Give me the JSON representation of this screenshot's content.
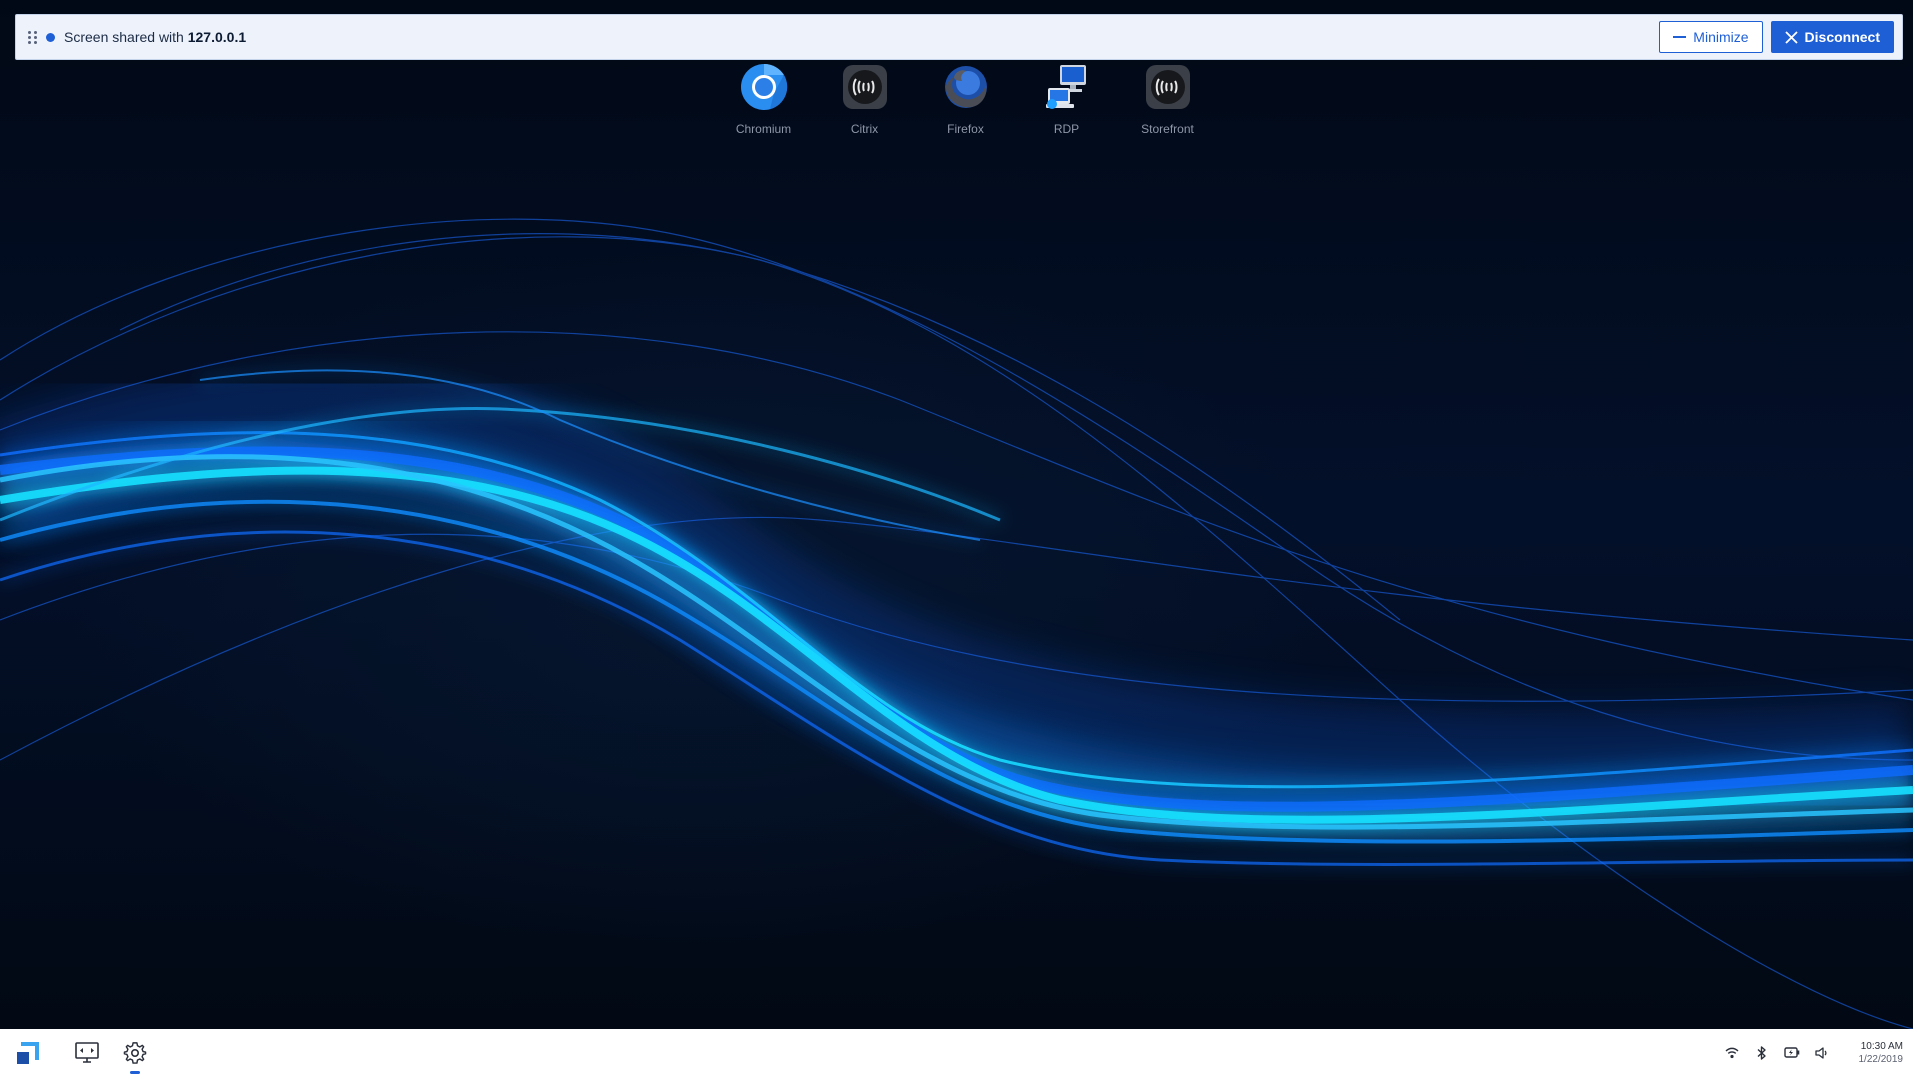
{
  "share_bar": {
    "text_prefix": "Screen shared with",
    "ip": "127.0.0.1",
    "minimize_label": "Minimize",
    "disconnect_label": "Disconnect"
  },
  "desktop_icons": [
    {
      "label": "Chromium",
      "icon": "chromium-icon"
    },
    {
      "label": "Citrix",
      "icon": "citrix-icon"
    },
    {
      "label": "Firefox",
      "icon": "firefox-icon"
    },
    {
      "label": "RDP",
      "icon": "rdp-icon"
    },
    {
      "label": "Storefront",
      "icon": "storefront-icon"
    }
  ],
  "taskbar": {
    "buttons": [
      "start-logo-icon",
      "display-settings-icon",
      "gear-icon"
    ],
    "tray": [
      "wifi-icon",
      "bluetooth-icon",
      "battery-icon",
      "volume-icon"
    ],
    "time": "10:30 AM",
    "date": "1/22/2019"
  },
  "colors": {
    "accent": "#1f5fd6",
    "banner_bg": "#eef3fb",
    "desktop_bg": "#030b1a",
    "wave_cyan": "#18e0ff",
    "wave_blue": "#0a6cff"
  }
}
